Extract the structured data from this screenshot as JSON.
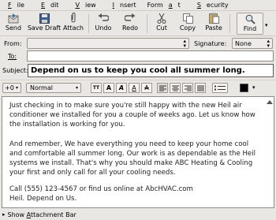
{
  "menu": {
    "items": [
      {
        "pre": "",
        "u": "F",
        "post": "ile"
      },
      {
        "pre": "",
        "u": "E",
        "post": "dit"
      },
      {
        "pre": "",
        "u": "V",
        "post": "iew"
      },
      {
        "pre": "",
        "u": "I",
        "post": "nsert"
      },
      {
        "pre": "Form",
        "u": "a",
        "post": "t"
      },
      {
        "pre": "",
        "u": "S",
        "post": "ecurity"
      }
    ]
  },
  "toolbar": {
    "send": "Send",
    "save_draft": "Save Draft",
    "attach": "Attach",
    "undo": "Undo",
    "redo": "Redo",
    "cut": "Cut",
    "copy": "Copy",
    "paste": "Paste",
    "find": "Find"
  },
  "from": {
    "label": "From:",
    "value": ""
  },
  "signature": {
    "label": "Signature:",
    "value": "None"
  },
  "to": {
    "label": "To:",
    "value": ""
  },
  "subject": {
    "label": "Subject:",
    "value": "Depend on us to keep you cool all summer long."
  },
  "format": {
    "indent": "+0",
    "paragraph_style": "Normal",
    "text_color": "#000000"
  },
  "body": {
    "p1": "Just checking in to make sure you're still happy with the new Heil air conditioner we installed for you a couple of weeks ago. Let us know how the installation is working for you.",
    "p2": "And remember, We have everything you need to keep your home cool and comfortable all summer long. Our work is as dependable as the Heil systems we install. That's why you should make ABC Heating & Cooling your first and only call for all your cooling needs.",
    "p3_line1": "Call (555) 123-4567 or find us online at AbcHVAC.com",
    "p3_line2": "Heil. Depend on Us."
  },
  "attachbar": {
    "label_pre": "Show ",
    "label_u": "A",
    "label_post": "ttachment Bar"
  }
}
